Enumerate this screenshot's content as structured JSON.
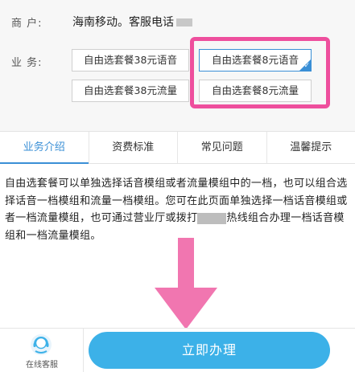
{
  "merchant": {
    "label": "商 户:",
    "value": "海南移动。客服电话"
  },
  "business": {
    "label": "业 务:",
    "options": [
      {
        "label": "自由选套餐38元语音",
        "selected": false
      },
      {
        "label": "自由选套餐8元语音",
        "selected": true
      },
      {
        "label": "自由选套餐38元流量",
        "selected": false
      },
      {
        "label": "自由选套餐8元流量",
        "selected": false
      }
    ]
  },
  "tabs": [
    {
      "label": "业务介绍",
      "active": true
    },
    {
      "label": "资费标准",
      "active": false
    },
    {
      "label": "常见问题",
      "active": false
    },
    {
      "label": "温馨提示",
      "active": false
    }
  ],
  "description": {
    "part1": "自由选套餐可以单独选择话音模组或者流量模组中的一档，也可以组合选择话音一档模组和流量一档模组。您可在此页面单独选择一档话音模组或者一档流量模组，也可通过营业厅或拨打",
    "part2": "热线组合办理一档话音模组和一档流量模组。"
  },
  "bottom": {
    "cs_label": "在线客服",
    "apply_label": "立即办理"
  },
  "colors": {
    "accent": "#3a8fd6",
    "apply_button": "#3cb1e8",
    "annotation_pink": "#ee4f9d"
  },
  "icons": {
    "customer_service": "headset-avatar-icon",
    "annotation_arrow": "down-arrow"
  }
}
